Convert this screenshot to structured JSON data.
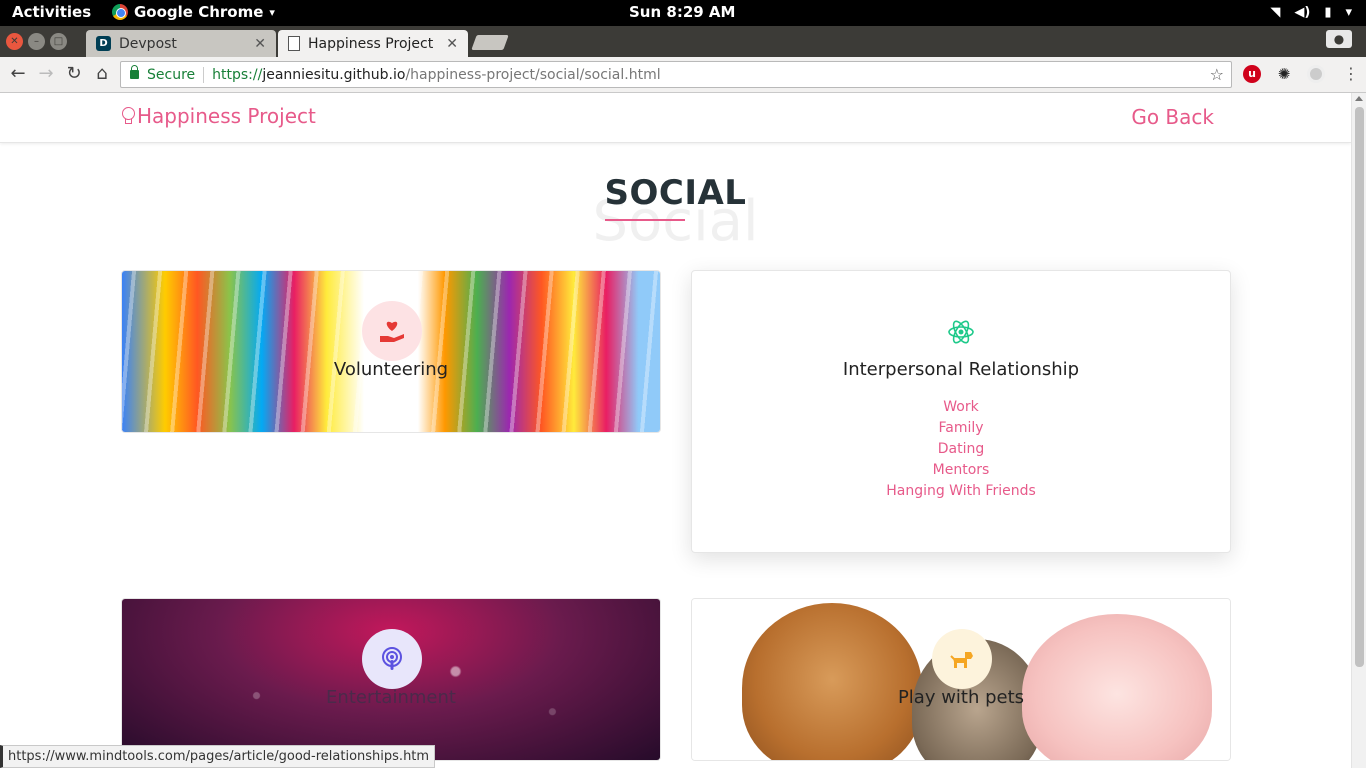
{
  "system": {
    "activities": "Activities",
    "app_name": "Google Chrome",
    "clock": "Sun  8:29 AM"
  },
  "browser": {
    "tabs": [
      {
        "title": "Devpost",
        "favicon": "D"
      },
      {
        "title": "Happiness Project"
      }
    ],
    "address": {
      "secure_label": "Secure",
      "protocol": "https://",
      "host": "jeanniesitu.github.io",
      "path": "/happiness-project/social/social.html"
    },
    "status_url": "https://www.mindtools.com/pages/article/good-relationships.htm"
  },
  "site": {
    "brand": "Happiness Project",
    "go_back": "Go Back",
    "accent_color": "#e75a8a"
  },
  "section": {
    "title": "SOCIAL",
    "background_word": "Social"
  },
  "cards": {
    "volunteering": {
      "label": "Volunteering",
      "icon": "heart-hand-icon",
      "icon_color": "#e53935"
    },
    "interpersonal": {
      "label": "Interpersonal Relationship",
      "icon": "atom-icon",
      "icon_color": "#1ec98a",
      "links": [
        "Work",
        "Family",
        "Dating",
        "Mentors",
        "Hanging With Friends"
      ]
    },
    "entertainment": {
      "label": "Entertainment",
      "icon": "podcast-icon",
      "icon_color": "#5c52e0"
    },
    "pets": {
      "label": "Play with pets",
      "icon": "dog-icon",
      "icon_color": "#f5a623"
    }
  }
}
